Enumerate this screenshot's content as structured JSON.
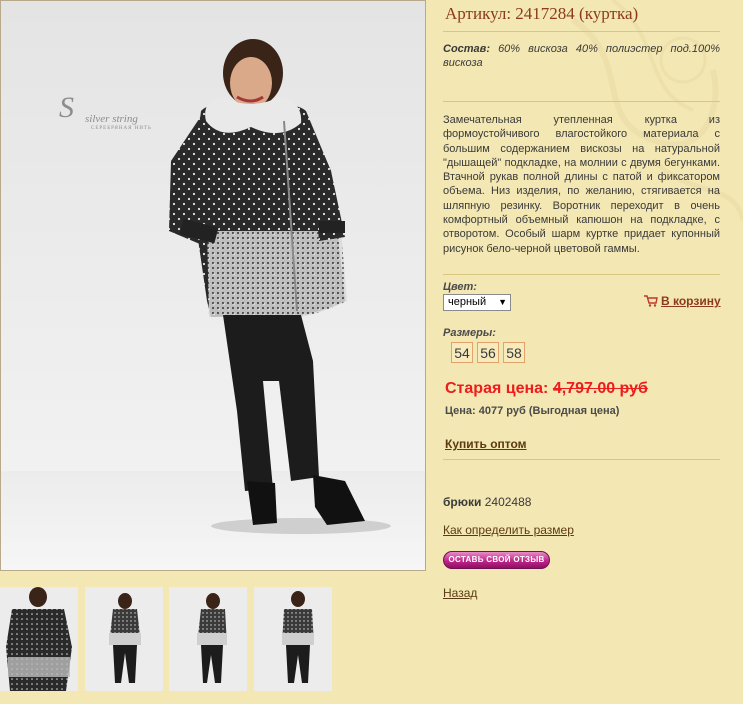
{
  "product": {
    "title": "Артикул: 2417284 (куртка)",
    "composition_label": "Состав:",
    "composition_value": "60% вискоза 40% полиэстер под.100% вискоза",
    "description": "Замечательная утепленная куртка из формоустойчивого влагостойкого материала с большим содержанием вискозы на натуральной \"дышащей\" подкладке, на молнии с двумя бегунками. Втачной рукав полной длины с патой и фиксатором объема. Низ изделия, по желанию, стягивается на шляпную резинку. Воротник переходит в очень комфортный объемный капюшон на подкладке, с отворотом. Особый шарм куртке придает купонный рисунок бело-черной цветовой гаммы.",
    "color_label": "Цвет:",
    "color_selected": "черный",
    "add_to_cart": "В корзину",
    "sizes_label": "Размеры:",
    "sizes": [
      "54",
      "56",
      "58"
    ],
    "old_price_label": "Старая цена:",
    "old_price_value": "4,797.00 руб",
    "price_text": "Цена: 4077 руб (Выгодная цена)",
    "wholesale_link": "Купить оптом",
    "pants_label": "брюки",
    "pants_code": "2402488",
    "size_guide_link": "Как определить размер",
    "review_button": "ОСТАВЬ СВОЙ ОТЗЫВ",
    "back_link": "Назад"
  },
  "brand": {
    "logo_text": "silver string",
    "logo_sub": "СЕРЕБРЯНАЯ НИТЬ"
  },
  "colors": {
    "background": "#f3e7b3",
    "title": "#8b3a1f",
    "old_price": "#ee1c1c",
    "size_border": "#e2a268",
    "review_button": "#c0268a"
  },
  "gallery": {
    "thumbnails": [
      "thumbnail-front",
      "thumbnail-back",
      "thumbnail-side",
      "thumbnail-front-full"
    ]
  }
}
